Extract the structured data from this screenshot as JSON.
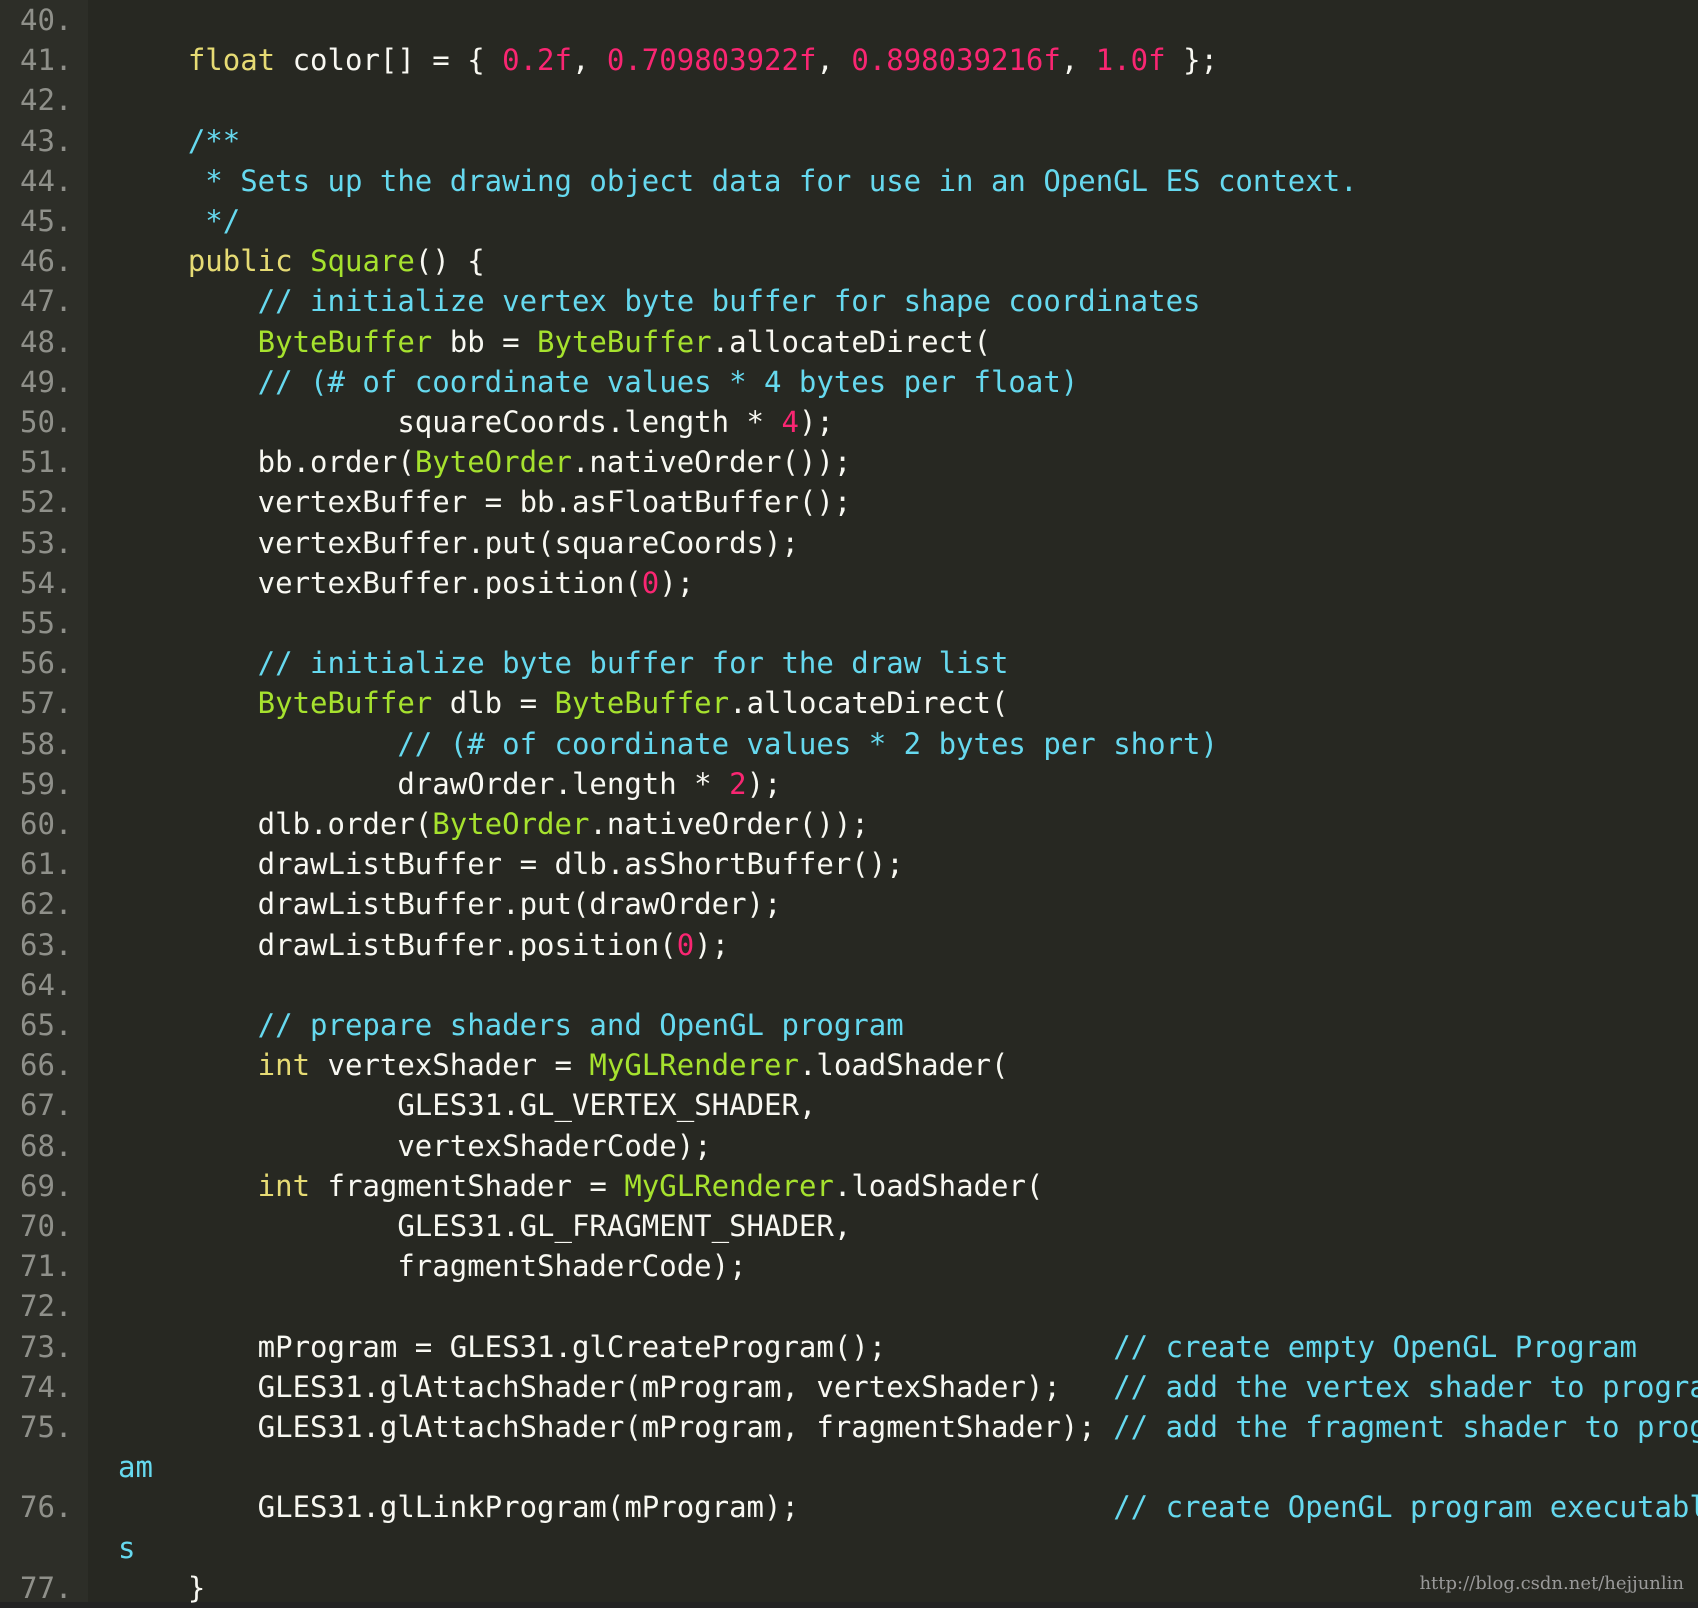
{
  "editor": {
    "lines": [
      {
        "num": "40.",
        "tokens": []
      },
      {
        "num": "41.",
        "tokens": [
          [
            "kw",
            "    float"
          ],
          [
            "pl",
            " color[] = { "
          ],
          [
            "num",
            "0.2f"
          ],
          [
            "pl",
            ", "
          ],
          [
            "num",
            "0.709803922f"
          ],
          [
            "pl",
            ", "
          ],
          [
            "num",
            "0.898039216f"
          ],
          [
            "pl",
            ", "
          ],
          [
            "num",
            "1.0f"
          ],
          [
            "pl",
            " };"
          ]
        ]
      },
      {
        "num": "42.",
        "tokens": []
      },
      {
        "num": "43.",
        "tokens": [
          [
            "cm",
            "    /**"
          ]
        ]
      },
      {
        "num": "44.",
        "tokens": [
          [
            "cm",
            "     * Sets up the drawing object data for use in an OpenGL ES context."
          ]
        ]
      },
      {
        "num": "45.",
        "tokens": [
          [
            "cm",
            "     */"
          ]
        ]
      },
      {
        "num": "46.",
        "tokens": [
          [
            "kw",
            "    public "
          ],
          [
            "ty",
            "Square"
          ],
          [
            "pl",
            "() {"
          ]
        ]
      },
      {
        "num": "47.",
        "tokens": [
          [
            "cm",
            "        // initialize vertex byte buffer for shape coordinates"
          ]
        ]
      },
      {
        "num": "48.",
        "tokens": [
          [
            "ty",
            "        ByteBuffer"
          ],
          [
            "pl",
            " bb = "
          ],
          [
            "ty",
            "ByteBuffer"
          ],
          [
            "pl",
            ".allocateDirect("
          ]
        ]
      },
      {
        "num": "49.",
        "tokens": [
          [
            "cm",
            "        // (# of coordinate values * 4 bytes per float)"
          ]
        ]
      },
      {
        "num": "50.",
        "tokens": [
          [
            "pl",
            "                squareCoords.length * "
          ],
          [
            "num",
            "4"
          ],
          [
            "pl",
            ");"
          ]
        ]
      },
      {
        "num": "51.",
        "tokens": [
          [
            "pl",
            "        bb.order("
          ],
          [
            "ty",
            "ByteOrder"
          ],
          [
            "pl",
            ".nativeOrder());"
          ]
        ]
      },
      {
        "num": "52.",
        "tokens": [
          [
            "pl",
            "        vertexBuffer = bb.asFloatBuffer();"
          ]
        ]
      },
      {
        "num": "53.",
        "tokens": [
          [
            "pl",
            "        vertexBuffer.put(squareCoords);"
          ]
        ]
      },
      {
        "num": "54.",
        "tokens": [
          [
            "pl",
            "        vertexBuffer.position("
          ],
          [
            "num",
            "0"
          ],
          [
            "pl",
            ");"
          ]
        ]
      },
      {
        "num": "55.",
        "tokens": []
      },
      {
        "num": "56.",
        "tokens": [
          [
            "cm",
            "        // initialize byte buffer for the draw list"
          ]
        ]
      },
      {
        "num": "57.",
        "tokens": [
          [
            "ty",
            "        ByteBuffer"
          ],
          [
            "pl",
            " dlb = "
          ],
          [
            "ty",
            "ByteBuffer"
          ],
          [
            "pl",
            ".allocateDirect("
          ]
        ]
      },
      {
        "num": "58.",
        "tokens": [
          [
            "cm",
            "                // (# of coordinate values * 2 bytes per short)"
          ]
        ]
      },
      {
        "num": "59.",
        "tokens": [
          [
            "pl",
            "                drawOrder.length * "
          ],
          [
            "num",
            "2"
          ],
          [
            "pl",
            ");"
          ]
        ]
      },
      {
        "num": "60.",
        "tokens": [
          [
            "pl",
            "        dlb.order("
          ],
          [
            "ty",
            "ByteOrder"
          ],
          [
            "pl",
            ".nativeOrder());"
          ]
        ]
      },
      {
        "num": "61.",
        "tokens": [
          [
            "pl",
            "        drawListBuffer = dlb.asShortBuffer();"
          ]
        ]
      },
      {
        "num": "62.",
        "tokens": [
          [
            "pl",
            "        drawListBuffer.put(drawOrder);"
          ]
        ]
      },
      {
        "num": "63.",
        "tokens": [
          [
            "pl",
            "        drawListBuffer.position("
          ],
          [
            "num",
            "0"
          ],
          [
            "pl",
            ");"
          ]
        ]
      },
      {
        "num": "64.",
        "tokens": []
      },
      {
        "num": "65.",
        "tokens": [
          [
            "cm",
            "        // prepare shaders and OpenGL program"
          ]
        ]
      },
      {
        "num": "66.",
        "tokens": [
          [
            "kw",
            "        int"
          ],
          [
            "pl",
            " vertexShader = "
          ],
          [
            "ty",
            "MyGLRenderer"
          ],
          [
            "pl",
            ".loadShader("
          ]
        ]
      },
      {
        "num": "67.",
        "tokens": [
          [
            "pl",
            "                GLES31.GL_VERTEX_SHADER,"
          ]
        ]
      },
      {
        "num": "68.",
        "tokens": [
          [
            "pl",
            "                vertexShaderCode);"
          ]
        ]
      },
      {
        "num": "69.",
        "tokens": [
          [
            "kw",
            "        int"
          ],
          [
            "pl",
            " fragmentShader = "
          ],
          [
            "ty",
            "MyGLRenderer"
          ],
          [
            "pl",
            ".loadShader("
          ]
        ]
      },
      {
        "num": "70.",
        "tokens": [
          [
            "pl",
            "                GLES31.GL_FRAGMENT_SHADER,"
          ]
        ]
      },
      {
        "num": "71.",
        "tokens": [
          [
            "pl",
            "                fragmentShaderCode);"
          ]
        ]
      },
      {
        "num": "72.",
        "tokens": []
      },
      {
        "num": "73.",
        "tokens": [
          [
            "pl",
            "        mProgram = GLES31.glCreateProgram();             "
          ],
          [
            "cm",
            "// create empty OpenGL Program"
          ]
        ]
      },
      {
        "num": "74.",
        "tokens": [
          [
            "pl",
            "        GLES31.glAttachShader(mProgram, vertexShader);   "
          ],
          [
            "cm",
            "// add the vertex shader to program"
          ]
        ]
      },
      {
        "num": "75.",
        "tokens": [
          [
            "pl",
            "        GLES31.glAttachShader(mProgram, fragmentShader); "
          ],
          [
            "cm",
            "// add the fragment shader to progr"
          ]
        ]
      },
      {
        "num": "",
        "cont": "am"
      },
      {
        "num": "76.",
        "tokens": [
          [
            "pl",
            "        GLES31.glLinkProgram(mProgram);                  "
          ],
          [
            "cm",
            "// create OpenGL program executable"
          ]
        ]
      },
      {
        "num": "",
        "cont": "s"
      },
      {
        "num": "77.",
        "tokens": [
          [
            "pl",
            "    }"
          ]
        ]
      }
    ]
  },
  "watermark": "http://blog.csdn.net/hejjunlin"
}
